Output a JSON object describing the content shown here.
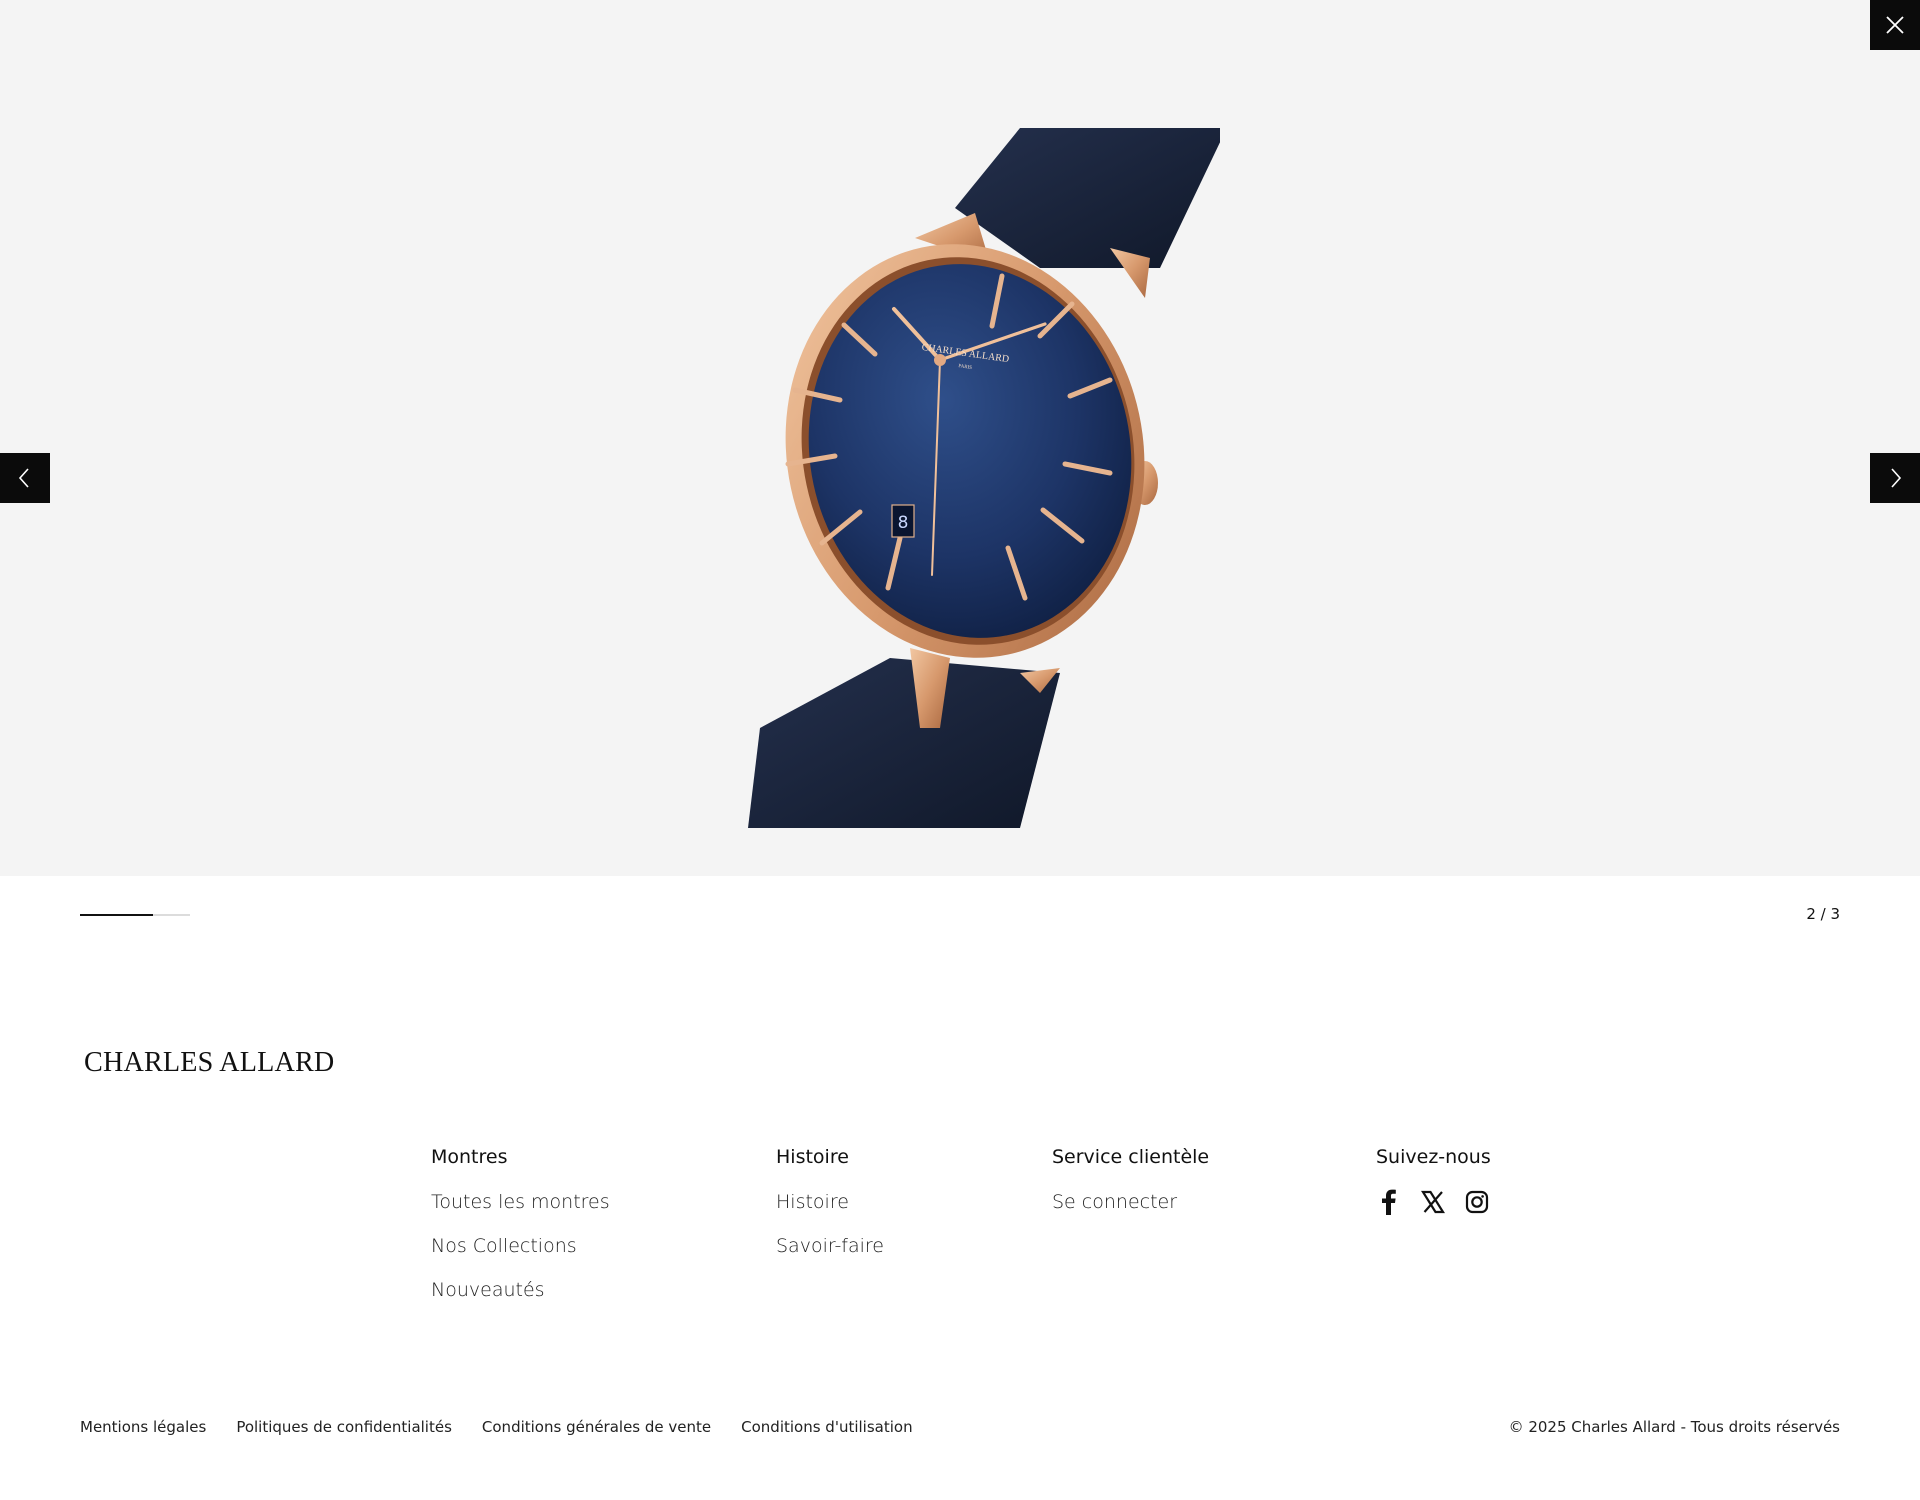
{
  "gallery": {
    "close_icon": "close-icon",
    "prev_icon": "chevron-left-icon",
    "next_icon": "chevron-right-icon",
    "image_alt": "watch-product-image",
    "brand_on_dial": "CHARLES ALLARD",
    "dial_city": "PARIS",
    "date_digit": "8",
    "progress": 0.667,
    "counter": "2 / 3"
  },
  "footer": {
    "logo": "CHARLES ALLARD",
    "columns": [
      {
        "title": "Montres",
        "links": [
          "Toutes les montres",
          "Nos Collections",
          "Nouveautés"
        ]
      },
      {
        "title": "Histoire",
        "links": [
          "Histoire",
          "Savoir-faire"
        ]
      },
      {
        "title": "Service clientèle",
        "links": [
          "Se connecter"
        ]
      },
      {
        "title": "Suivez-nous",
        "social": [
          "facebook-icon",
          "x-icon",
          "instagram-icon"
        ]
      }
    ],
    "legal_links": [
      "Mentions légales",
      "Politiques de confidentialités",
      "Conditions générales de vente",
      "Conditions d'utilisation"
    ],
    "copyright": "© 2025 Charles Allard - Tous droits réservés"
  },
  "colors": {
    "accent": "#0b0b0b",
    "gallery_bg": "#f4f4f4",
    "dial": "#1c3566",
    "gold": "#d9a37a",
    "strap": "#17213a"
  }
}
